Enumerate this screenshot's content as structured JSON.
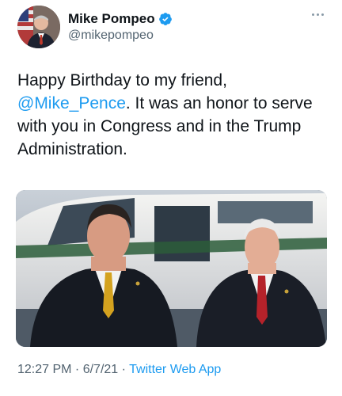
{
  "author": {
    "display_name": "Mike Pompeo",
    "handle": "@mikepompeo",
    "verified": true
  },
  "tweet": {
    "text_before": "Happy Birthday to my friend, ",
    "mention": "@Mike_Pence",
    "text_after": ". It was an honor to serve with you in Congress and in the Trump Administration."
  },
  "meta": {
    "time": "12:27 PM",
    "separator_1": " · ",
    "date": "6/7/21",
    "separator_2": " · ",
    "source": "Twitter Web App"
  },
  "icons": {
    "verified": "verified-badge-icon",
    "more": "more-options-icon"
  },
  "colors": {
    "link": "#1d9bf0",
    "verified": "#1d9bf0",
    "secondary_text": "#536471"
  }
}
